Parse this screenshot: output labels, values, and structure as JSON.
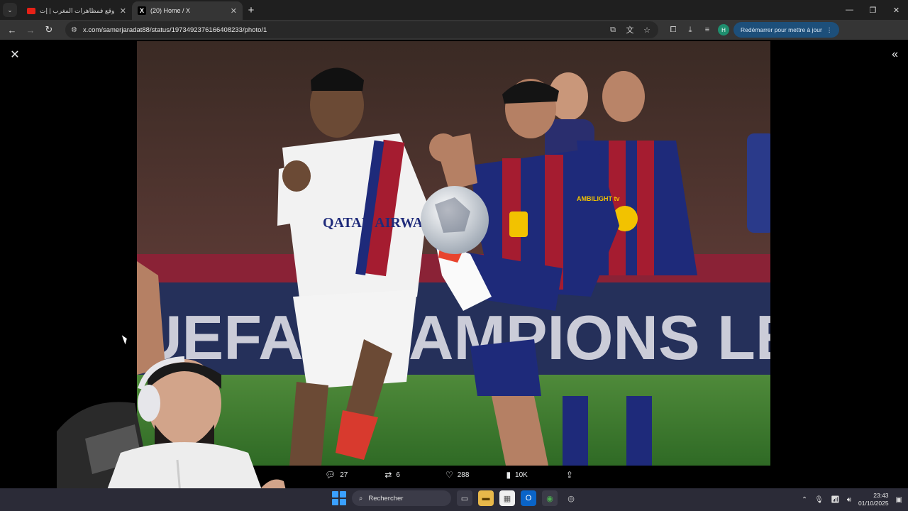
{
  "browser": {
    "tabs": [
      {
        "title": "شنو وقع فمظاهرات المغرب | إت...",
        "favicon": "youtube-icon",
        "active": false
      },
      {
        "title": "(20) Home / X",
        "favicon": "x-logo-icon",
        "active": true
      }
    ],
    "url": "x.com/samerjaradat88/status/1973492376166408233/photo/1",
    "profile_initial": "H",
    "update_label": "Redémarrer pour mettre à jour"
  },
  "tweet_actions": {
    "replies": "27",
    "reposts": "6",
    "likes": "288",
    "views": "10K"
  },
  "photo": {
    "jersey_sponsor_left": "QATAR AIRWAYS",
    "jersey_sponsor_right": "AMBILIGHT tv",
    "banner_text": "UEFA CHAMPIONS LEAGUE"
  },
  "taskbar": {
    "search_placeholder": "Rechercher",
    "time": "23:43",
    "date": "01/10/2025"
  },
  "colors": {
    "accent_update": "#1d4f7a",
    "psg_white": "#f2f2f2",
    "barca_blue": "#1e2a7a",
    "barca_red": "#a51c30"
  }
}
